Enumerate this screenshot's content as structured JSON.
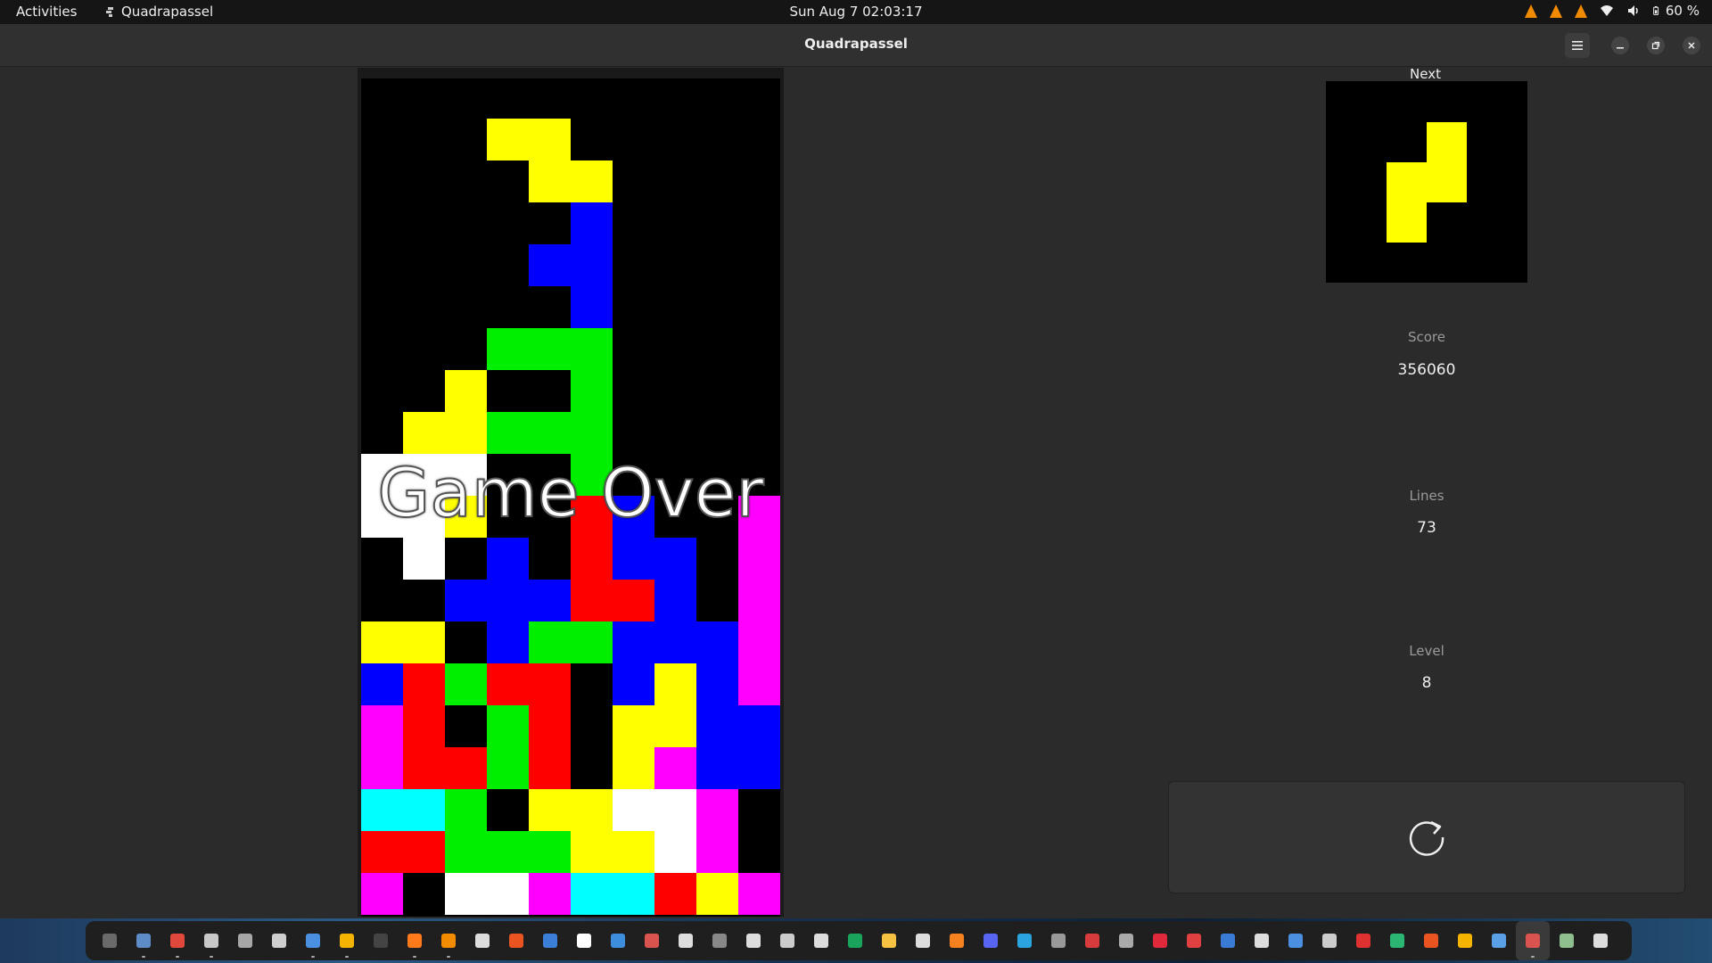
{
  "topbar": {
    "activities": "Activities",
    "app_name": "Quadrapassel",
    "clock": "Sun Aug 7  02:03:17",
    "battery": "60 %"
  },
  "window": {
    "title": "Quadrapassel"
  },
  "game": {
    "overlay": "Game Over",
    "colors": {
      "Y": "#ffff00",
      "B": "#0000ff",
      "G": "#00ee00",
      "R": "#ff0000",
      "M": "#ff00ff",
      "W": "#ffffff",
      "C": "#00ffff"
    },
    "board": [
      "..........",
      "...YY.....",
      "....YY....",
      ".....B....",
      "....BB....",
      ".....B....",
      "...GGG....",
      "..Y..G....",
      ".YYGGG....",
      "WWW..G....",
      "WWY..RB..M",
      ".W.B.RBB.M",
      "..BBBRRB.M",
      "YY.BGGBBBM",
      "BRGRR.BYBM",
      "MR.GR.YYBB",
      "MRRGR.YMBB",
      "CCG.YYWWM.",
      "RRGGGYYWM.",
      "M.WWMCCRYM"
    ]
  },
  "side": {
    "next_label": "Next",
    "next_piece": [
      "..Y",
      ".YY",
      ".Y."
    ],
    "score_label": "Score",
    "score": "356060",
    "lines_label": "Lines",
    "lines": "73",
    "level_label": "Level",
    "level": "8"
  },
  "dock": {
    "icons": [
      {
        "name": "system-monitor-icon",
        "color": "#6a6a6a",
        "run": false
      },
      {
        "name": "files-icon",
        "color": "#5e8cc9",
        "run": true
      },
      {
        "name": "chrome-icon",
        "color": "#e0483b",
        "run": true
      },
      {
        "name": "document-viewer-icon",
        "color": "#c8c8c8",
        "run": true
      },
      {
        "name": "archive-icon",
        "color": "#a7a7a7",
        "run": false
      },
      {
        "name": "image-viewer-icon",
        "color": "#cfcfcf",
        "run": false
      },
      {
        "name": "text-editor-icon",
        "color": "#4a8fe0",
        "run": true
      },
      {
        "name": "spreadsheet-icon",
        "color": "#f3b300",
        "run": true
      },
      {
        "name": "terminal-icon",
        "color": "#444444",
        "run": false
      },
      {
        "name": "firefox-icon",
        "color": "#ff7a1a",
        "run": true
      },
      {
        "name": "vlc-icon",
        "color": "#f28b00",
        "run": true
      },
      {
        "name": "obs-icon",
        "color": "#dddddd",
        "run": false
      },
      {
        "name": "software-center-icon",
        "color": "#e95420",
        "run": false
      },
      {
        "name": "writer-icon",
        "color": "#3b7fd8",
        "run": false
      },
      {
        "name": "presentation-icon",
        "color": "#ffffff",
        "run": false
      },
      {
        "name": "help-icon",
        "color": "#3e8ede",
        "run": false
      },
      {
        "name": "screenshot-icon",
        "color": "#d9534f",
        "run": false
      },
      {
        "name": "settings-icon",
        "color": "#dddddd",
        "run": false
      },
      {
        "name": "inkscape-icon",
        "color": "#888888",
        "run": false
      },
      {
        "name": "drawing-icon",
        "color": "#dddddd",
        "run": false
      },
      {
        "name": "3d-box-icon",
        "color": "#cccccc",
        "run": false
      },
      {
        "name": "camera-icon",
        "color": "#dddddd",
        "run": false
      },
      {
        "name": "calc-icon",
        "color": "#19a35b",
        "run": false
      },
      {
        "name": "notes-icon",
        "color": "#f5c242",
        "run": false
      },
      {
        "name": "music-icon",
        "color": "#dddddd",
        "run": false
      },
      {
        "name": "impress-icon",
        "color": "#f6821f",
        "run": false
      },
      {
        "name": "discord-icon",
        "color": "#5865f2",
        "run": false
      },
      {
        "name": "telegram-icon",
        "color": "#2aa3df",
        "run": false
      },
      {
        "name": "chess-icon",
        "color": "#999999",
        "run": false
      },
      {
        "name": "mail-icon",
        "color": "#d83b3b",
        "run": false
      },
      {
        "name": "calculator-icon",
        "color": "#aaaaaa",
        "run": false
      },
      {
        "name": "video-icon",
        "color": "#e0293a",
        "run": false
      },
      {
        "name": "calendar-icon",
        "color": "#e04040",
        "run": false
      },
      {
        "name": "docs-icon",
        "color": "#3a7bd5",
        "run": false
      },
      {
        "name": "accessibility-icon",
        "color": "#dddddd",
        "run": false
      },
      {
        "name": "sudoku-icon",
        "color": "#4a8fe0",
        "run": false
      },
      {
        "name": "clock-icon",
        "color": "#cccccc",
        "run": false
      },
      {
        "name": "cards-icon",
        "color": "#e03131",
        "run": false
      },
      {
        "name": "mines-icon",
        "color": "#2bb673",
        "run": false
      },
      {
        "name": "robot-icon",
        "color": "#e95420",
        "run": false
      },
      {
        "name": "weather-icon",
        "color": "#f5b400",
        "run": false
      },
      {
        "name": "remote-icon",
        "color": "#5aa0e6",
        "run": false
      },
      {
        "name": "quadrapassel-icon",
        "color": "#d9534f",
        "run": true,
        "active": true
      },
      {
        "name": "trash-icon",
        "color": "#8fbf8f",
        "run": false
      },
      {
        "name": "show-apps-icon",
        "color": "#dddddd",
        "run": false
      }
    ]
  }
}
